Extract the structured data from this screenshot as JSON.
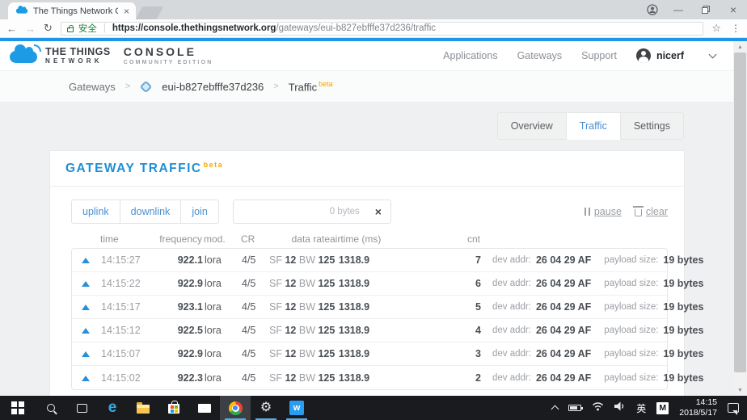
{
  "browser": {
    "tab_title": "The Things Network Co",
    "secure_label": "安全",
    "url_scheme": "https://",
    "url_domain": "console.thethingsnetwork.org",
    "url_path": "/gateways/eui-b827ebfffe37d236/traffic"
  },
  "icons": {
    "back": "←",
    "forward": "→",
    "refresh": "↻",
    "star": "☆",
    "menu": "⋮",
    "minimize": "—",
    "close": "×",
    "tab_close": "×",
    "gear": "⚙",
    "scroll_up": "▲",
    "scroll_down": "▼",
    "edge": "e",
    "wapp": "ᴡ"
  },
  "site_header": {
    "brand_line1": "THE THINGS",
    "brand_line2": "NETWORK",
    "console_line1": "CONSOLE",
    "console_line2": "COMMUNITY EDITION",
    "nav": [
      "Applications",
      "Gateways",
      "Support"
    ],
    "username": "nicerf"
  },
  "breadcrumb": {
    "root": "Gateways",
    "separator": ">",
    "gateway_id": "eui-b827ebfffe37d236",
    "page": "Traffic",
    "beta": "beta"
  },
  "tabs": [
    {
      "label": "Overview",
      "active": false
    },
    {
      "label": "Traffic",
      "active": true
    },
    {
      "label": "Settings",
      "active": false
    }
  ],
  "traffic": {
    "title": "GATEWAY TRAFFIC",
    "beta": "beta",
    "filters": [
      "uplink",
      "downlink",
      "join"
    ],
    "bytes_value": "0 bytes",
    "pause_label": "pause",
    "clear_label": "clear",
    "columns": [
      "time",
      "frequency",
      "mod.",
      "CR",
      "data rate",
      "airtime (ms)",
      "cnt"
    ],
    "sf_label": "SF",
    "bw_label": "BW",
    "dev_addr_label": "dev addr:",
    "payload_label": "payload size:",
    "rows": [
      {
        "time": "14:15:27",
        "frequency": "922.1",
        "mod": "lora",
        "cr": "4/5",
        "sf": "12",
        "bw": "125",
        "airtime": "1318.9",
        "cnt": "7",
        "dev_addr": "26 04 29 AF",
        "payload": "19 bytes"
      },
      {
        "time": "14:15:22",
        "frequency": "922.9",
        "mod": "lora",
        "cr": "4/5",
        "sf": "12",
        "bw": "125",
        "airtime": "1318.9",
        "cnt": "6",
        "dev_addr": "26 04 29 AF",
        "payload": "19 bytes"
      },
      {
        "time": "14:15:17",
        "frequency": "923.1",
        "mod": "lora",
        "cr": "4/5",
        "sf": "12",
        "bw": "125",
        "airtime": "1318.9",
        "cnt": "5",
        "dev_addr": "26 04 29 AF",
        "payload": "19 bytes"
      },
      {
        "time": "14:15:12",
        "frequency": "922.5",
        "mod": "lora",
        "cr": "4/5",
        "sf": "12",
        "bw": "125",
        "airtime": "1318.9",
        "cnt": "4",
        "dev_addr": "26 04 29 AF",
        "payload": "19 bytes"
      },
      {
        "time": "14:15:07",
        "frequency": "922.9",
        "mod": "lora",
        "cr": "4/5",
        "sf": "12",
        "bw": "125",
        "airtime": "1318.9",
        "cnt": "3",
        "dev_addr": "26 04 29 AF",
        "payload": "19 bytes"
      },
      {
        "time": "14:15:02",
        "frequency": "922.3",
        "mod": "lora",
        "cr": "4/5",
        "sf": "12",
        "bw": "125",
        "airtime": "1318.9",
        "cnt": "2",
        "dev_addr": "26 04 29 AF",
        "payload": "19 bytes"
      }
    ]
  },
  "taskbar": {
    "ime_lang": "英",
    "ime_mode": "M",
    "time": "14:15",
    "date": "2018/5/17"
  },
  "colors": {
    "accent_blue": "#1e8fd5",
    "link_blue": "#4a90d2",
    "beta_orange": "#f5a700",
    "secure_green": "#188038",
    "topbar_blue": "#2095e8",
    "taskbar_underline": "#5fa8dc"
  }
}
